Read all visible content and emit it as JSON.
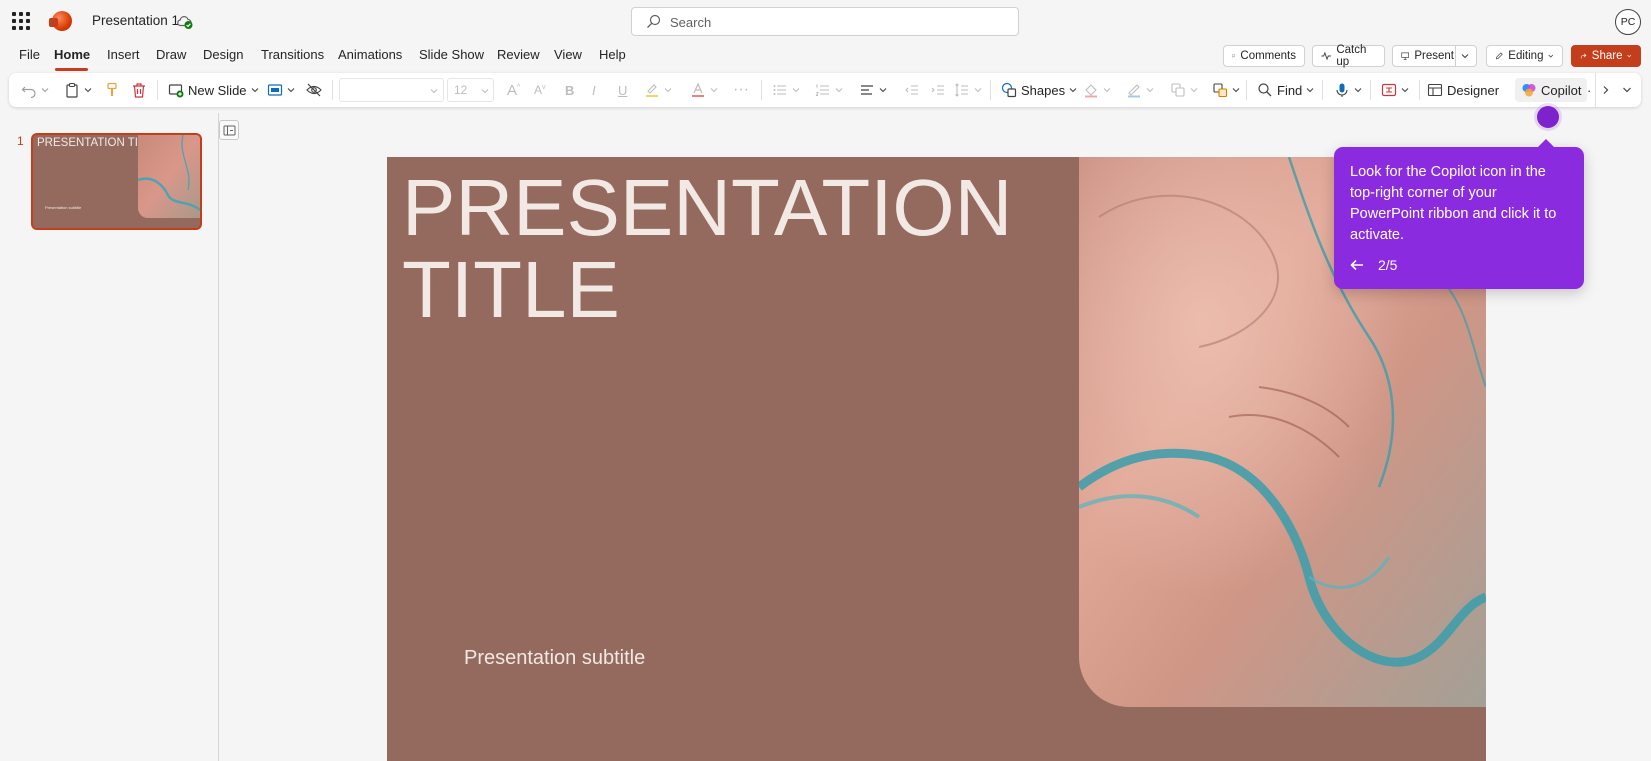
{
  "app": {
    "doc_title": "Presentation 1",
    "avatar_initials": "PC"
  },
  "search": {
    "placeholder": "Search"
  },
  "menu": {
    "items": [
      "File",
      "Home",
      "Insert",
      "Draw",
      "Design",
      "Transitions",
      "Animations",
      "Slide Show",
      "Review",
      "View",
      "Help"
    ],
    "active": "Home"
  },
  "actions": {
    "comments": "Comments",
    "catch_up": "Catch up",
    "present": "Present",
    "editing": "Editing",
    "share": "Share"
  },
  "ribbon": {
    "new_slide": "New Slide",
    "font_size": "12",
    "shapes": "Shapes",
    "find": "Find",
    "designer": "Designer",
    "copilot": "Copilot"
  },
  "thumbnail": {
    "number": "1",
    "title": "PRESENTATION TITLE",
    "subtitle": "Presentation subtitle"
  },
  "slide": {
    "title_line1": "PRESENTATION",
    "title_line2": "TITLE",
    "subtitle": "Presentation subtitle"
  },
  "tip": {
    "text": "Look for the Copilot icon in the top-right corner of your PowerPoint ribbon and click it to activate.",
    "step": "2/5"
  },
  "colors": {
    "accent": "#c43e1c",
    "slide_bg": "#946a5f",
    "tip_bg": "#8b2be0"
  }
}
